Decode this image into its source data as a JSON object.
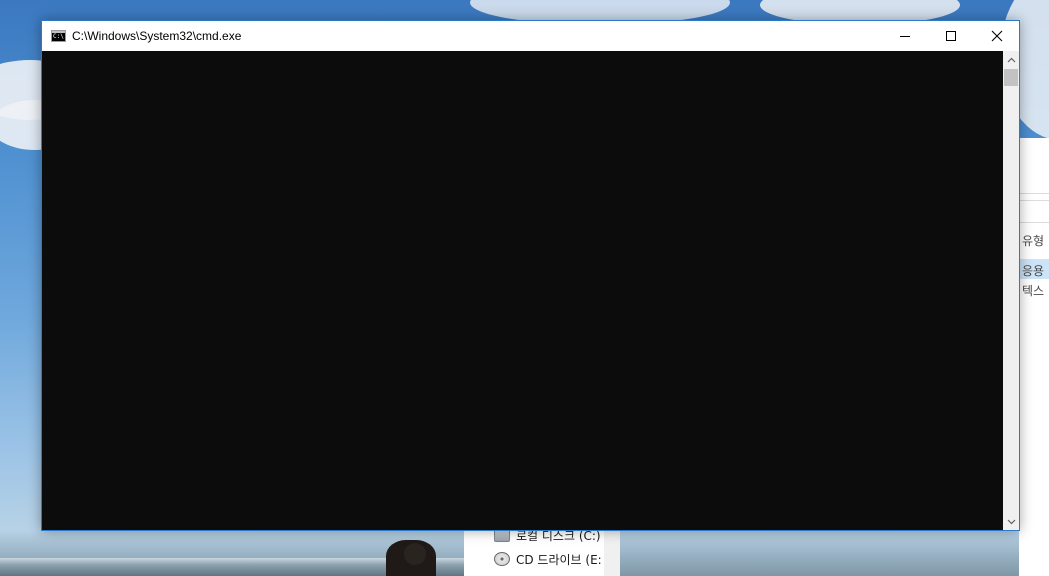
{
  "window": {
    "title": "C:\\Windows\\System32\\cmd.exe",
    "accent_color": "#2b79c9",
    "console_background": "#0c0c0c",
    "icon": "cmd-icon",
    "caption_buttons": [
      "minimize-icon",
      "maximize-icon",
      "close-icon"
    ]
  },
  "console": {
    "text": ""
  },
  "scrollbar": {
    "up_icon": "chevron-up-icon",
    "down_icon": "chevron-down-icon"
  },
  "background_explorer": {
    "column_header": "유형",
    "rows": [
      "응용",
      "텍스"
    ],
    "nav_items": [
      {
        "label": "로컬 디스크 (C:)",
        "icon": "drive-icon"
      },
      {
        "label": "CD 드라이브 (E:",
        "icon": "cd-drive-icon"
      }
    ]
  }
}
